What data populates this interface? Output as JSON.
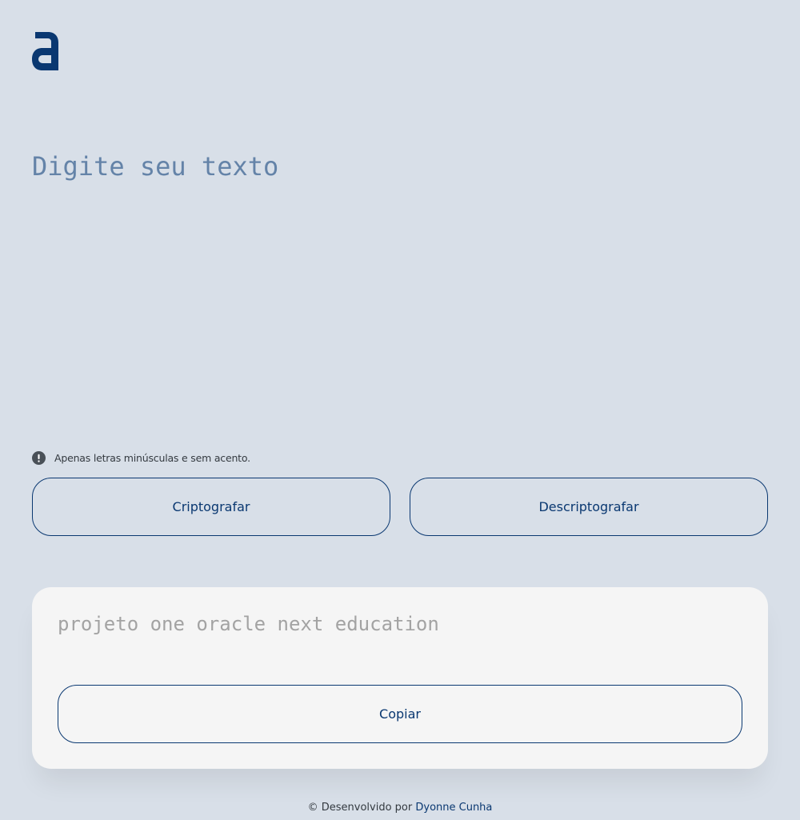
{
  "header": {
    "logo_icon": "alura-a-logo"
  },
  "input": {
    "placeholder": "Digite seu texto",
    "value": ""
  },
  "hint": {
    "icon": "exclamation-circle-icon",
    "text": "Apenas letras minúsculas e sem acento."
  },
  "actions": {
    "encrypt_label": "Criptografar",
    "decrypt_label": "Descriptografar"
  },
  "output": {
    "text": "projeto one oracle next education",
    "copy_label": "Copiar"
  },
  "footer": {
    "prefix": "© Desenvolvido por",
    "author": "Dyonne Cunha"
  },
  "colors": {
    "background": "#D8DFE8",
    "primary": "#0A3871",
    "placeholder": "#6483A8",
    "card": "#F5F5F5",
    "output_text": "#A3A3A3",
    "hint_text": "#343A40"
  }
}
